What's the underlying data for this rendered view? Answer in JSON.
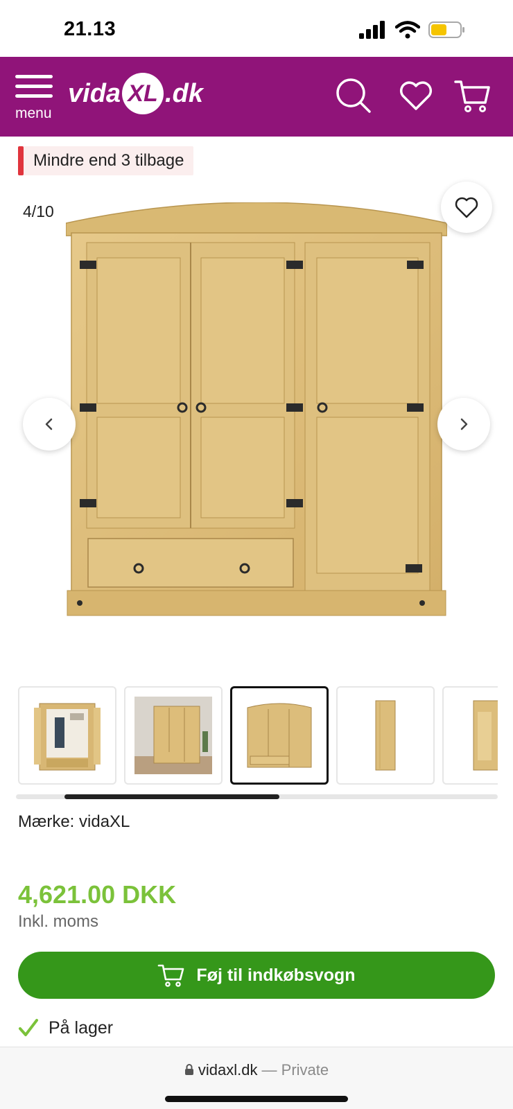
{
  "status": {
    "time": "21.13"
  },
  "header": {
    "menu_label": "menu",
    "logo_left": "vida",
    "logo_mark": "XL",
    "logo_right": ".dk"
  },
  "stock_tag": "Mindre end 3 tilbage",
  "gallery": {
    "counter": "4/10",
    "active_thumb": 3,
    "thumb_count_visible": 5
  },
  "product": {
    "brand": "Mærke: vidaXL",
    "price": "4,621.00 DKK",
    "vat_note": "Inkl. moms",
    "add_to_cart": "Føj til indkøbsvogn",
    "availability": "På lager"
  },
  "browser": {
    "domain": "vidaxl.dk",
    "separator": " — ",
    "mode": "Private"
  },
  "colors": {
    "brand_purple": "#901479",
    "price_green": "#7bc23a",
    "cart_green": "#35971a",
    "low_stock_red": "#e0343d"
  }
}
